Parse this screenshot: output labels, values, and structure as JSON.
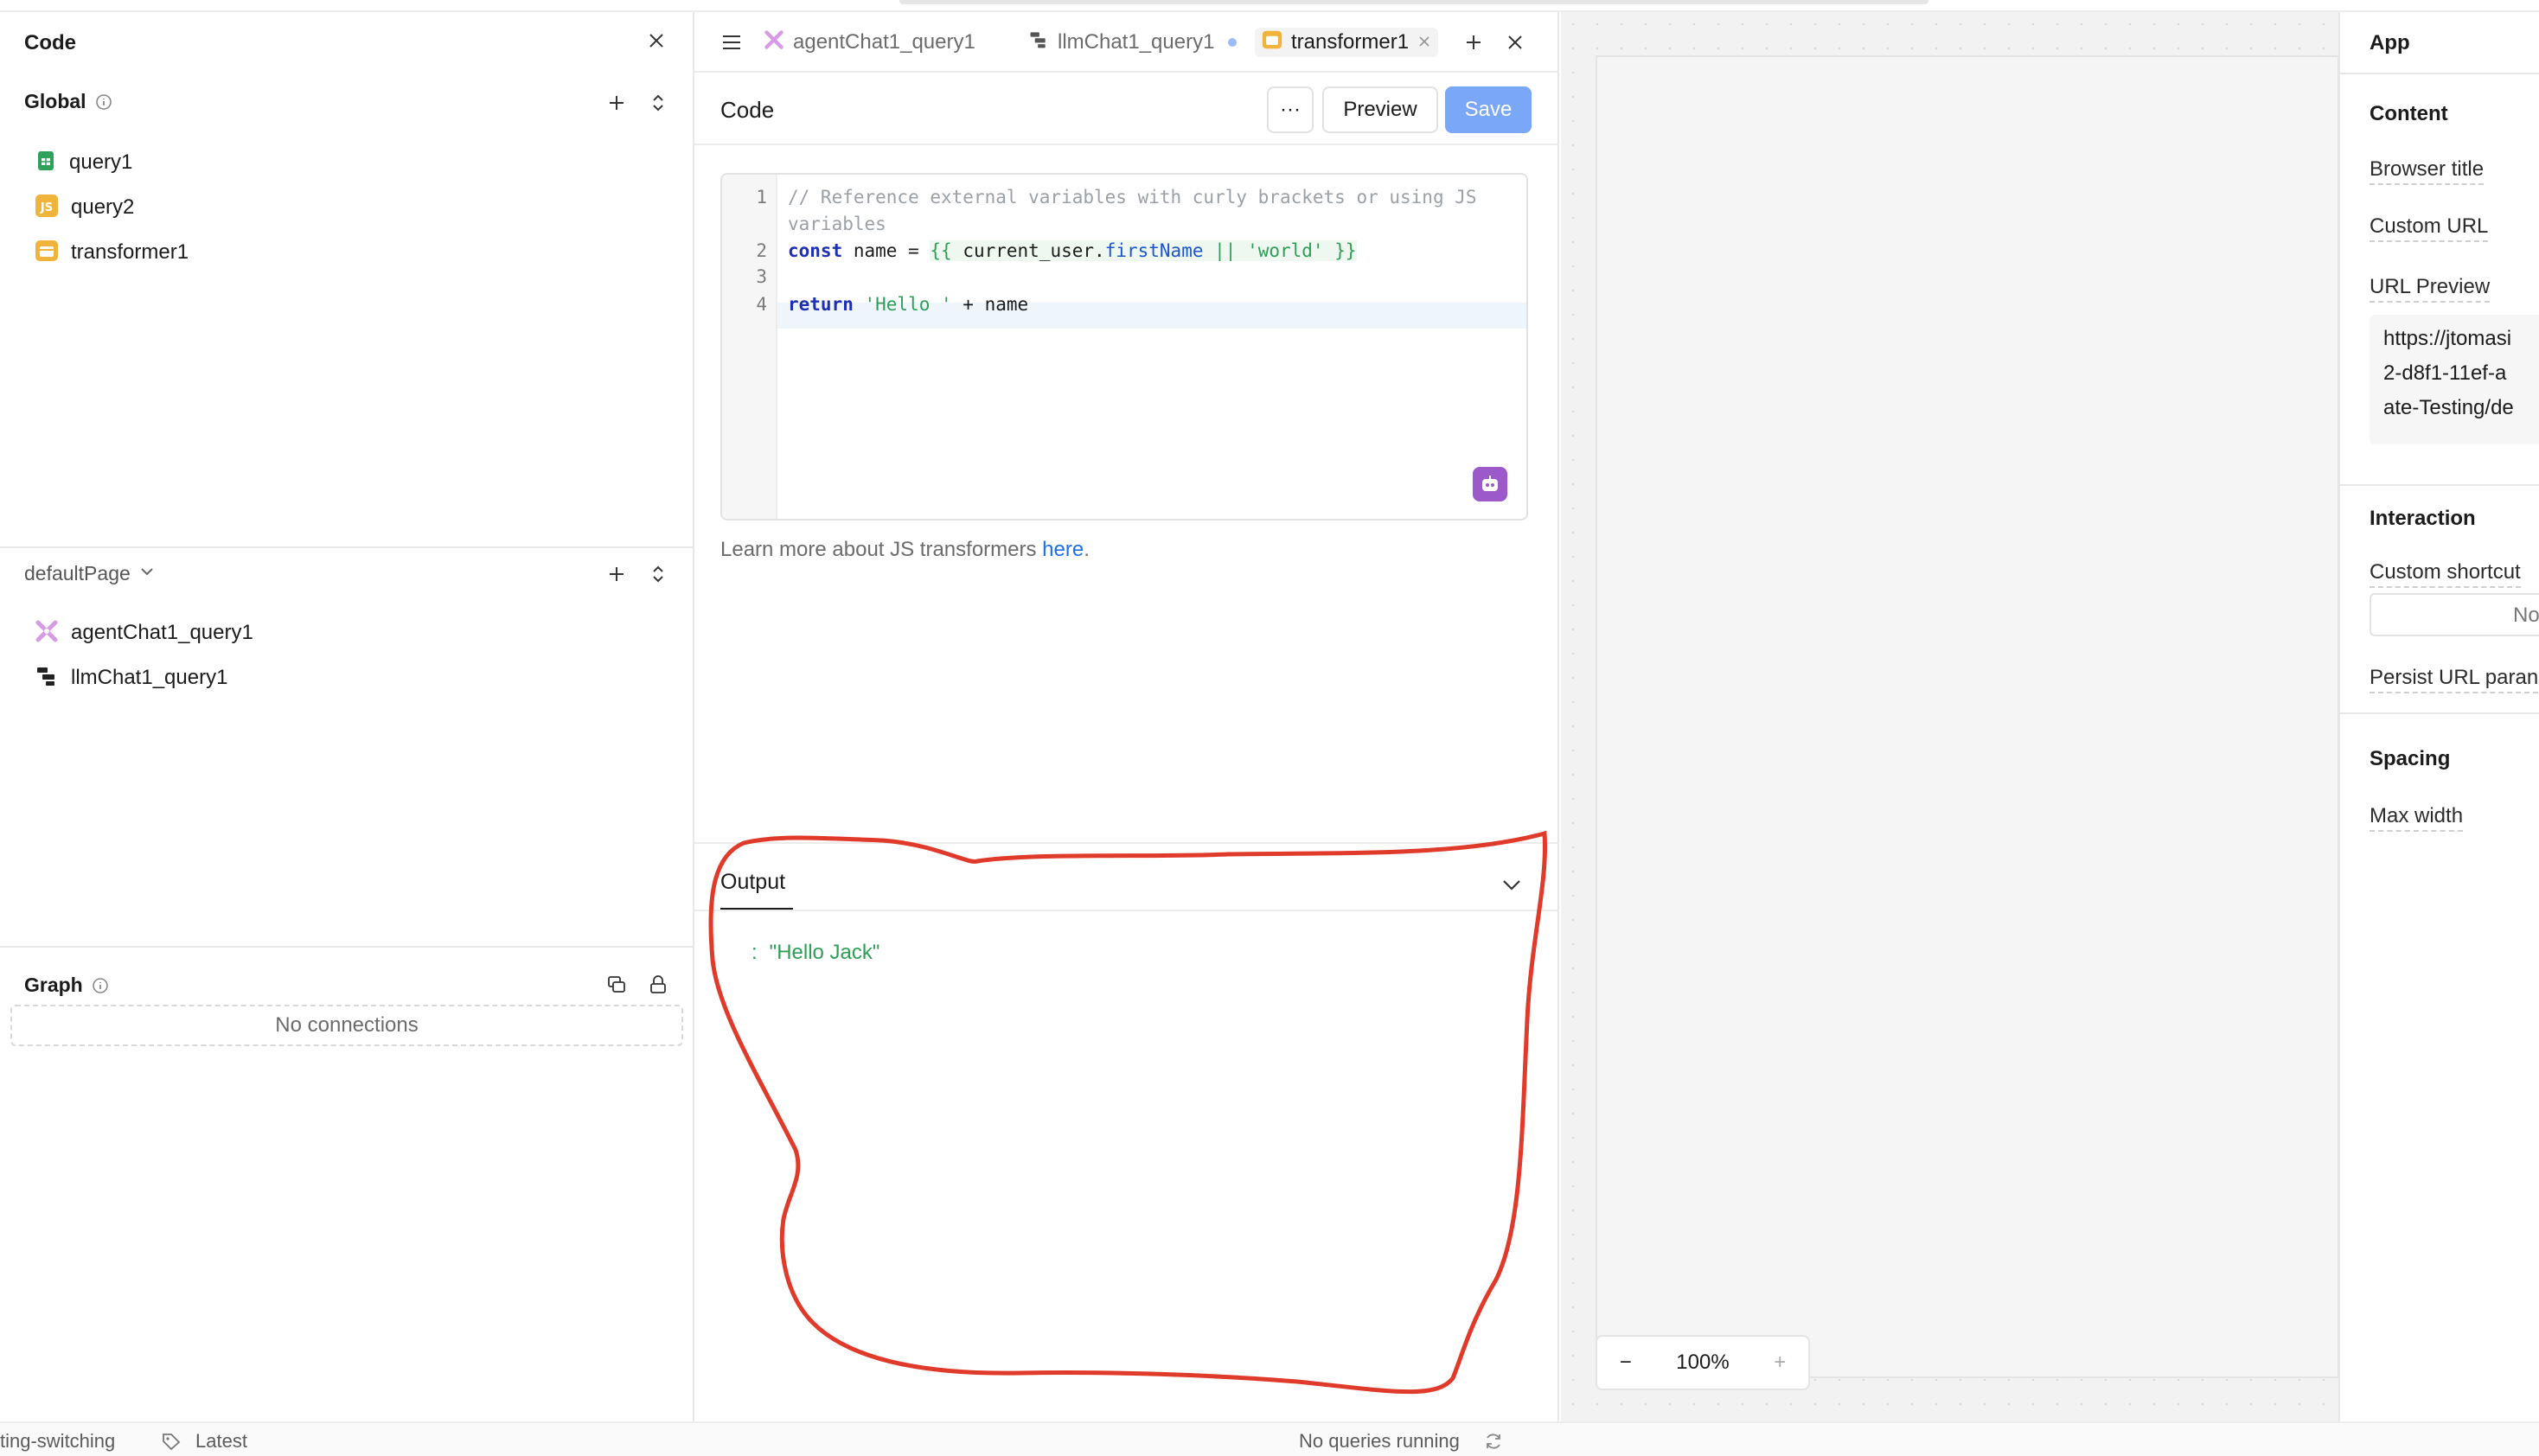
{
  "left_panel": {
    "title": "Code",
    "global_section": {
      "label": "Global",
      "items": [
        {
          "label": "query1",
          "icon": "sheets-icon"
        },
        {
          "label": "query2",
          "icon": "js-icon"
        },
        {
          "label": "transformer1",
          "icon": "transformer-icon"
        }
      ]
    },
    "page_section": {
      "label": "defaultPage",
      "items": [
        {
          "label": "agentChat1_query1",
          "icon": "agent-icon"
        },
        {
          "label": "llmChat1_query1",
          "icon": "llm-icon"
        }
      ]
    },
    "graph_section": {
      "label": "Graph",
      "empty_text": "No connections"
    }
  },
  "editor_panel": {
    "tabs": [
      {
        "label": "agentChat1_query1",
        "icon": "agent-icon"
      },
      {
        "label": "llmChat1_query1",
        "icon": "llm-icon"
      },
      {
        "label": "transformer1",
        "icon": "transformer-icon"
      }
    ],
    "title": "Code",
    "more_label": "···",
    "preview_label": "Preview",
    "save_label": "Save",
    "line_numbers": [
      "1",
      "2",
      "3",
      "4"
    ],
    "code": {
      "line1": "// Reference external variables with curly brackets or using JS",
      "line1b": "variables",
      "l2_const": "const",
      "l2_name": " name = ",
      "l2_open": "{{ ",
      "l2_obj": "current_user",
      "l2_dot": ".",
      "l2_prop": "firstName",
      "l2_or": " || ",
      "l2_str": "'world'",
      "l2_close": " }}",
      "l4_return": "return",
      "l4_str": " 'Hello '",
      "l4_rest": " + name"
    },
    "help_text": "Learn more about JS transformers ",
    "help_link": "here",
    "help_period": ".",
    "output_label": "Output",
    "output_colon": ":",
    "output_value": "\"Hello Jack\""
  },
  "canvas": {
    "zoom_minus": "−",
    "zoom_value": "100%",
    "zoom_plus": "+"
  },
  "right_panel": {
    "title": "App",
    "content_header": "Content",
    "browser_title": "Browser title",
    "custom_url": "Custom URL",
    "url_preview": "URL Preview",
    "url_line1": "https://jtomasi",
    "url_line2": "2-d8f1-11ef-a",
    "url_line3": "ate-Testing/de",
    "interaction_header": "Interaction",
    "custom_shortcut": "Custom shortcut",
    "shortcut_value": "No",
    "persist_url": "Persist URL paran",
    "spacing_header": "Spacing",
    "max_width": "Max width"
  },
  "status_bar": {
    "branch": "ting-switching",
    "version": "Latest",
    "queries": "No queries running"
  },
  "colors": {
    "accent": "#7aa7f7",
    "annotation": "#e03a2a",
    "link": "#1f6feb"
  }
}
